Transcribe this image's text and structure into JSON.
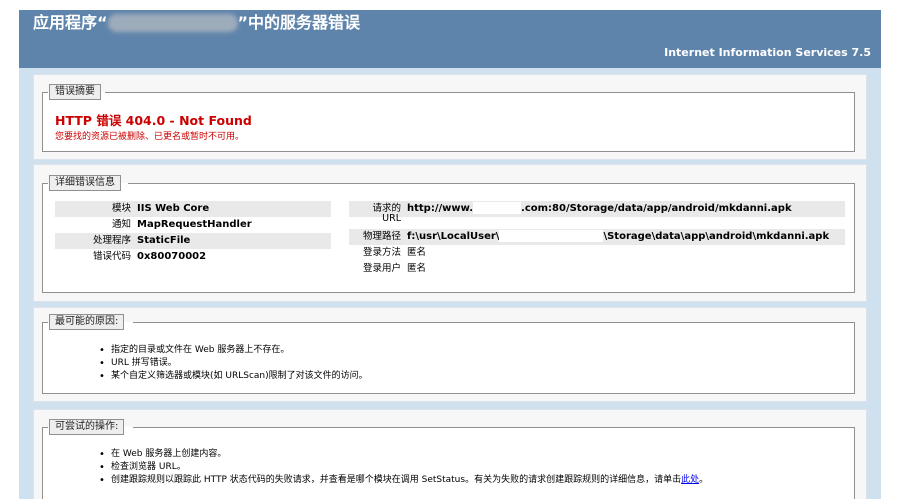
{
  "header": {
    "title_prefix": "应用程序“",
    "title_suffix": "”中的服务器错误",
    "server": "Internet Information Services 7.5"
  },
  "summary": {
    "legend": "错误摘要",
    "error_title": "HTTP 错误 404.0 - Not Found",
    "error_message": "您要找的资源已被删除、已更名或暂时不可用。"
  },
  "details": {
    "legend": "详细错误信息",
    "left": [
      {
        "label": "模块",
        "value": "IIS Web Core"
      },
      {
        "label": "通知",
        "value": "MapRequestHandler"
      },
      {
        "label": "处理程序",
        "value": "StaticFile"
      },
      {
        "label": "错误代码",
        "value": "0x80070002"
      }
    ],
    "right": {
      "url_label_1": "请求的",
      "url_label_2": "URL",
      "url_prefix": "http://www.",
      "url_suffix": ".com:80/Storage/data/app/android/mkdanni.apk",
      "path_label": "物理路径",
      "path_prefix": "f:\\usr\\LocalUser\\",
      "path_suffix": "\\Storage\\data\\app\\android\\mkdanni.apk",
      "logon_method_label": "登录方法",
      "logon_method_value": "匿名",
      "logon_user_label": "登录用户",
      "logon_user_value": "匿名"
    }
  },
  "causes": {
    "legend": "最可能的原因:",
    "items": [
      "指定的目录或文件在 Web 服务器上不存在。",
      "URL 拼写错误。",
      "某个自定义筛选器或模块(如 URLScan)限制了对该文件的访问。"
    ]
  },
  "actions": {
    "legend": "可尝试的操作:",
    "items": [
      "在 Web 服务器上创建内容。",
      "检查浏览器 URL。"
    ],
    "item3_text": "创建跟踪规则以跟踪此 HTTP 状态代码的失败请求，并查看是哪个模块在调用 SetStatus。有关为失败的请求创建跟踪规则的详细信息，请单击",
    "item3_link": "此处",
    "item3_end": "。"
  }
}
